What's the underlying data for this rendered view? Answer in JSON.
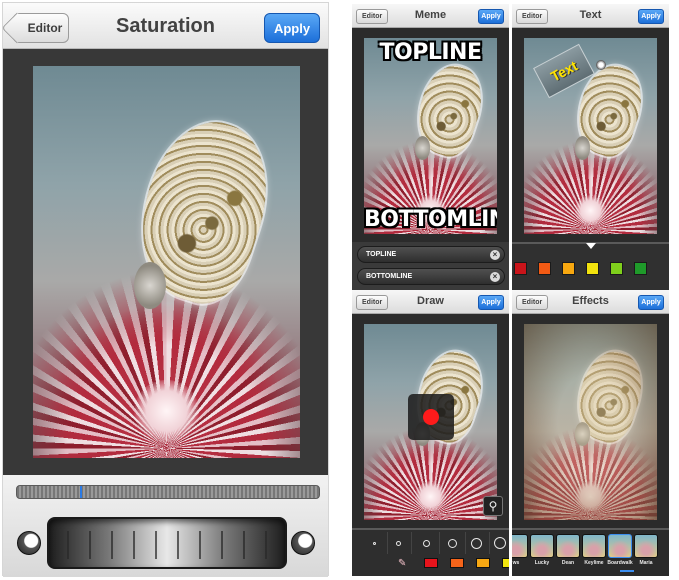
{
  "saturation_screen": {
    "back_label": "Editor",
    "title": "Saturation",
    "apply_label": "Apply",
    "progress": 0.21
  },
  "meme_screen": {
    "back_label": "Editor",
    "title": "Meme",
    "apply_label": "Apply",
    "top_text": "TOPLINE",
    "bottom_text": "BOTTOMLINE",
    "top_field_value": "TOPLINE",
    "bottom_field_value": "BOTTOMLINE"
  },
  "text_screen": {
    "back_label": "Editor",
    "title": "Text",
    "apply_label": "Apply",
    "sticker_text": "Text",
    "colors": [
      "#c9141a",
      "#f25a14",
      "#f8a810",
      "#f2e20e",
      "#7fcf1c",
      "#1f9a2a"
    ]
  },
  "draw_screen": {
    "back_label": "Editor",
    "title": "Draw",
    "apply_label": "Apply",
    "brush_color": "#ff1b1b",
    "colors": [
      "#e8141c",
      "#f5641a",
      "#f7a813",
      "#f2e60f"
    ]
  },
  "effects_screen": {
    "back_label": "Editor",
    "title": "Effects",
    "apply_label": "Apply",
    "filters": [
      "ws",
      "Lucky",
      "Dean",
      "Keylime",
      "Boardwalk",
      "Maria"
    ],
    "selected_filter": "Boardwalk"
  },
  "icons": [
    "back-chevron-icon",
    "close-icon",
    "zoom-icon",
    "eraser-icon"
  ]
}
